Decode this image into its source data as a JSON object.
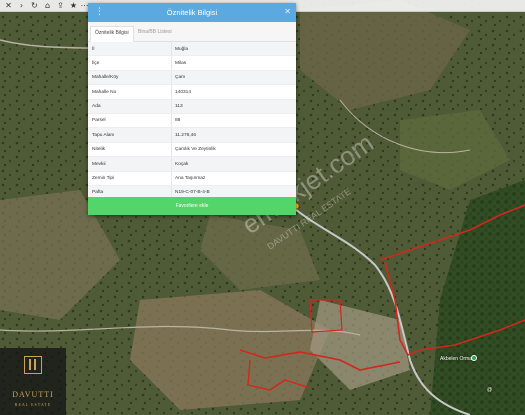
{
  "toolbar": {
    "icons": [
      "close-icon",
      "forward-icon",
      "refresh-icon",
      "home-icon",
      "share-icon",
      "bookmark-icon",
      "menu-icon"
    ]
  },
  "panel": {
    "title": "Öznitelik Bilgisi",
    "tabs": [
      "Öznitelik Bilgisi",
      "Bina/BB Listesi"
    ],
    "rows": [
      {
        "key": "İl",
        "value": "Muğla"
      },
      {
        "key": "İlçe",
        "value": "Milas"
      },
      {
        "key": "Mahalle/Köy",
        "value": "Çam"
      },
      {
        "key": "Mahalle No",
        "value": "140314"
      },
      {
        "key": "Ada",
        "value": "113"
      },
      {
        "key": "Parsel",
        "value": "88"
      },
      {
        "key": "Tapu Alanı",
        "value": "11.276,46"
      },
      {
        "key": "Nitelik",
        "value": "Çamlık Ve Zeytinlik"
      },
      {
        "key": "Mevkii",
        "value": "Koçak"
      },
      {
        "key": "Zemin Tipi",
        "value": "Ana Taşınmaz"
      },
      {
        "key": "Pafta",
        "value": "N19-C-07-B-4-B"
      }
    ],
    "favorite_button": "Favorilere ekle"
  },
  "watermark": {
    "text": "emlakjet.com",
    "sub": "DAVUTTI REAL ESTATE"
  },
  "logo": {
    "name": "DAVUTTI",
    "sub": "REAL ESTATE"
  },
  "map": {
    "place_label": "Akbelen Ormanı",
    "coord_label": "@"
  },
  "colors": {
    "header": "#5aa9e0",
    "button": "#52d66a",
    "boundary": "#d4261e",
    "road": "#c8c8c8",
    "pin": "#f0b020",
    "logo_gold": "#c9a35a"
  }
}
